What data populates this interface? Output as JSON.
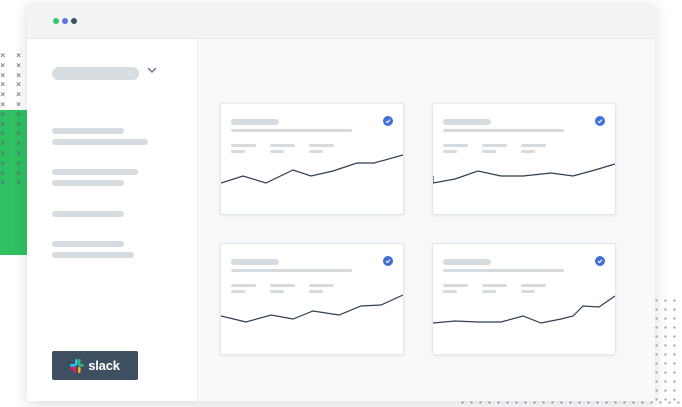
{
  "slack": {
    "label": "slack"
  },
  "colors": {
    "accent_green": "#2fc061",
    "check_blue": "#3f6fd8",
    "button_dark": "#3d4f61",
    "line": "#2f3e51",
    "window_dot_1": "#35c46b",
    "window_dot_2": "#5b73e6",
    "window_dot_3": "#3d4f61"
  },
  "icons": {
    "dropdown": "chevron-down-icon",
    "card_status": "check-circle-icon",
    "slack_logo": "slack-logo-icon"
  },
  "cards": [
    {
      "id": "top-left",
      "checked": true
    },
    {
      "id": "top-right",
      "checked": true
    },
    {
      "id": "bottom-left",
      "checked": true
    },
    {
      "id": "bottom-right",
      "checked": true
    }
  ]
}
